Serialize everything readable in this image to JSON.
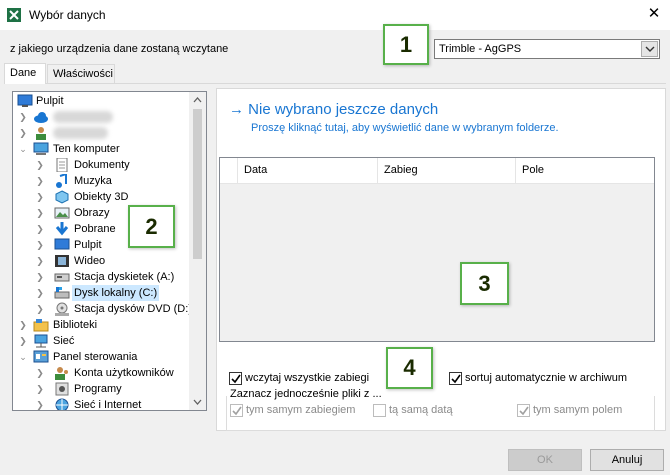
{
  "window": {
    "title": "Wybór danych",
    "icon": "excel-app-icon"
  },
  "source": {
    "label": "z jakiego urządzenia dane zostaną wczytane",
    "selected_device": "Trimble - AgGPS"
  },
  "callouts": [
    "1",
    "2",
    "3",
    "4"
  ],
  "tabs": [
    {
      "label": "Dane",
      "active": true
    },
    {
      "label": "Właściwości",
      "active": false
    }
  ],
  "tree": {
    "items": [
      {
        "label": "Pulpit",
        "icon": "desktop-icon"
      },
      {
        "label": "",
        "icon": "onedrive-cloud-icon"
      },
      {
        "label": "",
        "icon": "user-icon"
      },
      {
        "label": "Ten komputer",
        "icon": "computer-icon"
      },
      {
        "label": "Dokumenty",
        "icon": "documents-icon"
      },
      {
        "label": "Muzyka",
        "icon": "music-icon"
      },
      {
        "label": "Obiekty 3D",
        "icon": "objects-3d-icon"
      },
      {
        "label": "Obrazy",
        "icon": "pictures-icon"
      },
      {
        "label": "Pobrane",
        "icon": "downloads-icon"
      },
      {
        "label": "Pulpit",
        "icon": "desktop-icon"
      },
      {
        "label": "Wideo",
        "icon": "video-icon"
      },
      {
        "label": "Stacja dyskietek (A:)",
        "icon": "floppy-icon"
      },
      {
        "label": "Dysk lokalny (C:)",
        "icon": "local-disk-icon"
      },
      {
        "label": "Stacja dysków DVD (D:)",
        "icon": "dvd-drive-icon"
      },
      {
        "label": "Biblioteki",
        "icon": "libraries-icon"
      },
      {
        "label": "Sieć",
        "icon": "network-icon"
      },
      {
        "label": "Panel sterowania",
        "icon": "control-panel-icon"
      },
      {
        "label": "Konta użytkowników",
        "icon": "user-accounts-icon"
      },
      {
        "label": "Programy",
        "icon": "programs-icon"
      },
      {
        "label": "Sieć i Internet",
        "icon": "network-internet-icon"
      }
    ],
    "selected": "Dysk lokalny (C:)"
  },
  "data_panel": {
    "title": "Nie wybrano jeszcze danych",
    "hint": "Proszę kliknąć tutaj, aby wyświetlić dane w wybranym folderze.",
    "columns": [
      "",
      "Data",
      "Zabieg",
      "Pole"
    ]
  },
  "options": {
    "load_all": {
      "label": "wczytaj wszystkie zabiegi",
      "checked": true
    },
    "auto_sort": {
      "label": "sortuj automatycznie w archiwum",
      "checked": true
    },
    "group_label": "Zaznacz jednocześnie pliki z ...",
    "same_treatment": {
      "label": "tym samym zabiegiem",
      "checked": true,
      "enabled": false
    },
    "same_date": {
      "label": "tą samą datą",
      "checked": false,
      "enabled": false
    },
    "same_field": {
      "label": "tym samym polem",
      "checked": true,
      "enabled": false
    }
  },
  "buttons": {
    "ok": "OK",
    "cancel": "Anuluj"
  },
  "colors": {
    "accent": "#1976d2",
    "callout_border": "#58b04a",
    "selection": "#cce8ff"
  }
}
